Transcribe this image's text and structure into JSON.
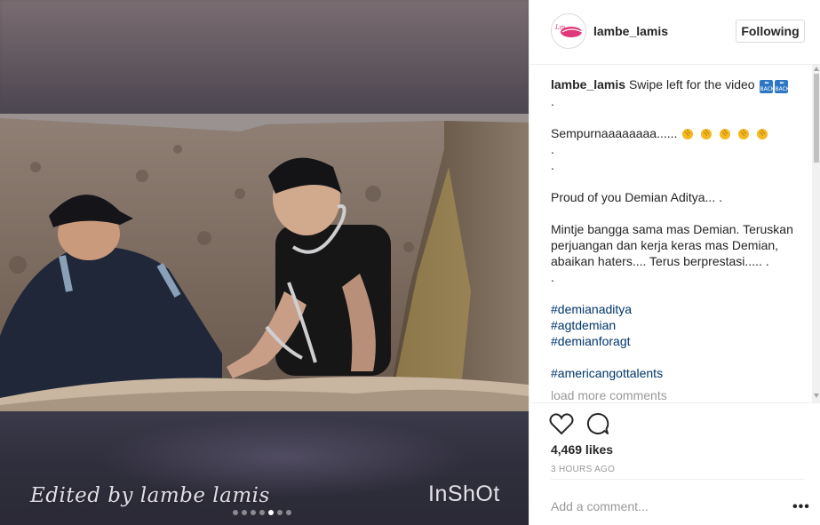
{
  "media": {
    "watermark_left": "Edited by lambe lamis",
    "watermark_right": "InShOt",
    "carousel_count": 7,
    "carousel_active": 5
  },
  "header": {
    "username": "lambe_lamis",
    "follow_label": "Following",
    "avatar_icon": "pink-lips-avatar-icon"
  },
  "comments": {
    "caption_user": "lambe_lamis",
    "caption_text": "Swipe left for the video",
    "caption_emoji": "back-arrow-icon",
    "lines": [
      ".",
      "",
      "Sempurnaaaaaaaa......",
      ".",
      ".",
      "",
      "Proud of you Demian Aditya... .",
      "",
      "Mintje bangga sama mas Demian. Teruskan",
      "perjuangan dan kerja keras mas Demian,",
      "abaikan haters.... Terus berprestasi..... .",
      ".",
      ""
    ],
    "clap_emoji_count": 5,
    "hashtags": [
      "#demianaditya",
      "#agtdemian",
      "#demianforagt",
      "",
      "#americangottalents"
    ],
    "load_more": "load more comments"
  },
  "actions": {
    "likes": "4,469 likes",
    "time": "3 HOURS AGO"
  },
  "add_comment": {
    "placeholder": "Add a comment...",
    "more": "•••"
  }
}
